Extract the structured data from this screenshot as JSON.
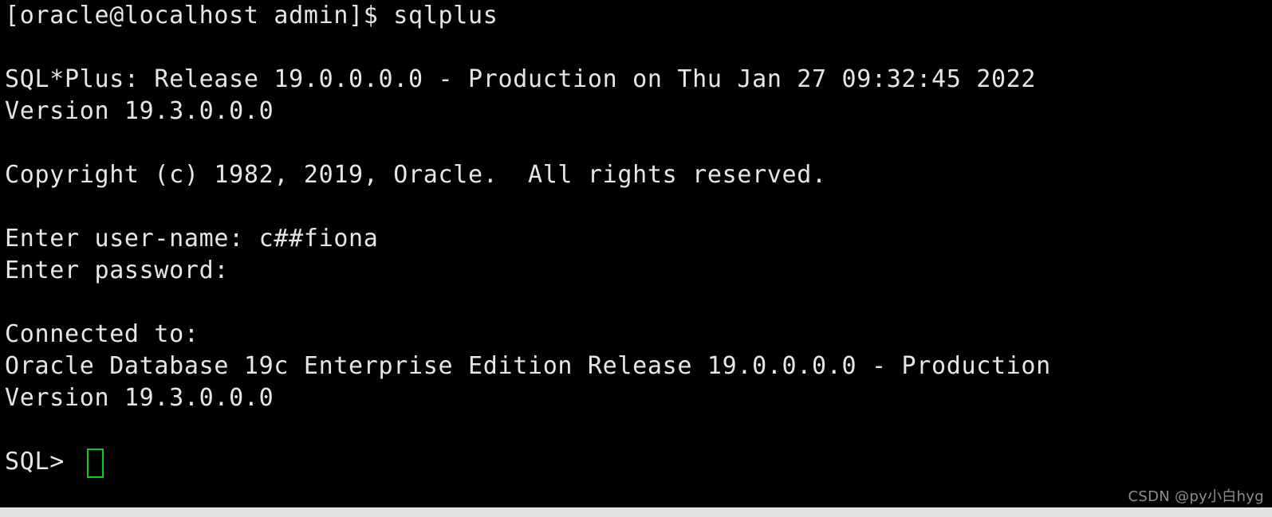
{
  "terminal": {
    "background_color": "#000000",
    "foreground_color": "#e6e6e6",
    "cursor_color": "#00d21a",
    "lines": [
      {
        "id": "shell-prompt-command",
        "text": "[oracle@localhost admin]$ sqlplus"
      },
      {
        "id": "blank-1",
        "text": ""
      },
      {
        "id": "sqlplus-banner-release",
        "text": "SQL*Plus: Release 19.0.0.0.0 - Production on Thu Jan 27 09:32:45 2022"
      },
      {
        "id": "sqlplus-banner-version",
        "text": "Version 19.3.0.0.0"
      },
      {
        "id": "blank-2",
        "text": ""
      },
      {
        "id": "copyright-notice",
        "text": "Copyright (c) 1982, 2019, Oracle.  All rights reserved."
      },
      {
        "id": "blank-3",
        "text": ""
      },
      {
        "id": "enter-username-line",
        "text": "Enter user-name: c##fiona"
      },
      {
        "id": "enter-password-line",
        "text": "Enter password:"
      },
      {
        "id": "blank-4",
        "text": ""
      },
      {
        "id": "connected-to-label",
        "text": "Connected to:"
      },
      {
        "id": "database-edition-line",
        "text": "Oracle Database 19c Enterprise Edition Release 19.0.0.0.0 - Production"
      },
      {
        "id": "database-version-line",
        "text": "Version 19.3.0.0.0"
      },
      {
        "id": "blank-5",
        "text": ""
      }
    ],
    "prompt": {
      "text": "SQL> ",
      "cursor": "block-outline"
    }
  },
  "watermark": {
    "text": "CSDN @py小白hyg",
    "color": "#8d8d8d"
  },
  "bottom_strip": {
    "color": "#e2e2e2"
  }
}
